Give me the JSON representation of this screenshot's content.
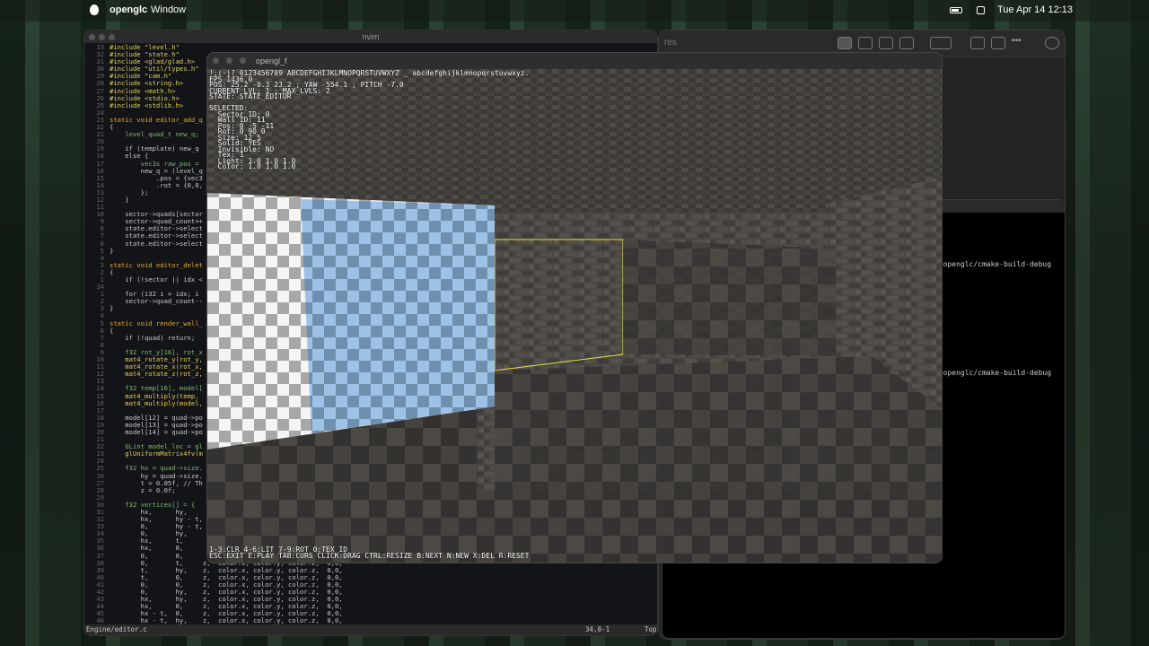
{
  "menubar": {
    "app_name": "openglc",
    "menu": [
      "Window"
    ],
    "clock": "Tue Apr 14  12:13"
  },
  "finder": {
    "title": "res"
  },
  "terminal": {
    "lines": [
      "s/openglc/cmake-build-debug",
      "s/openglc/cmake-build-debug"
    ]
  },
  "nvim": {
    "title": "nvim",
    "status_file": "Engine/editor.c",
    "status_pos": "34,0-1",
    "status_scroll": "Top",
    "lines": [
      {
        "n": "33",
        "t": "#include \"level.h\"",
        "c": "pp"
      },
      {
        "n": "32",
        "t": "#include \"state.h\"",
        "c": "pp"
      },
      {
        "n": "31",
        "t": "#include <glad/glad.h>",
        "c": "pp"
      },
      {
        "n": "30",
        "t": "#include \"util/types.h\"",
        "c": "pp"
      },
      {
        "n": "29",
        "t": "#include \"cam.h\"",
        "c": "pp"
      },
      {
        "n": "28",
        "t": "#include <string.h>",
        "c": "pp"
      },
      {
        "n": "27",
        "t": "#include <math.h>",
        "c": "pp"
      },
      {
        "n": "26",
        "t": "#include <stdio.h>",
        "c": "pp"
      },
      {
        "n": "25",
        "t": "#include <stdlib.h>",
        "c": "pp"
      },
      {
        "n": "24",
        "t": "",
        "c": ""
      },
      {
        "n": "23",
        "t": "static void editor_add_q",
        "c": "kw"
      },
      {
        "n": "22",
        "t": "{",
        "c": ""
      },
      {
        "n": "21",
        "t": "    level_quad_t new_q;",
        "c": "ty"
      },
      {
        "n": "20",
        "t": "",
        "c": ""
      },
      {
        "n": "19",
        "t": "    if (template) new_q",
        "c": ""
      },
      {
        "n": "18",
        "t": "    else {",
        "c": ""
      },
      {
        "n": "17",
        "t": "        vec3s raw_pos =",
        "c": "ty"
      },
      {
        "n": "16",
        "t": "        new_q = (level_q",
        "c": ""
      },
      {
        "n": "15",
        "t": "            .pos = {vec3",
        "c": ""
      },
      {
        "n": "14",
        "t": "            .rot = {0,0,",
        "c": ""
      },
      {
        "n": "13",
        "t": "        };",
        "c": ""
      },
      {
        "n": "12",
        "t": "    }",
        "c": ""
      },
      {
        "n": "11",
        "t": "",
        "c": ""
      },
      {
        "n": "10",
        "t": "    sector->quads[sector",
        "c": ""
      },
      {
        "n": "9",
        "t": "    sector->quad_count++",
        "c": ""
      },
      {
        "n": "8",
        "t": "    state.editor->select",
        "c": ""
      },
      {
        "n": "7",
        "t": "    state.editor->select",
        "c": ""
      },
      {
        "n": "6",
        "t": "    state.editor->select",
        "c": ""
      },
      {
        "n": "5",
        "t": "}",
        "c": ""
      },
      {
        "n": "4",
        "t": "",
        "c": ""
      },
      {
        "n": "3",
        "t": "static void editor_delet",
        "c": "kw"
      },
      {
        "n": "2",
        "t": "{",
        "c": ""
      },
      {
        "n": "1",
        "t": "    if (!sector || idx <",
        "c": ""
      },
      {
        "n": "34",
        "t": "",
        "c": ""
      },
      {
        "n": "1",
        "t": "    for (i32 i = idx; i",
        "c": ""
      },
      {
        "n": "2",
        "t": "    sector->quad_count--",
        "c": ""
      },
      {
        "n": "3",
        "t": "}",
        "c": ""
      },
      {
        "n": "4",
        "t": "",
        "c": ""
      },
      {
        "n": "5",
        "t": "static void render_wall_",
        "c": "kw"
      },
      {
        "n": "6",
        "t": "{",
        "c": ""
      },
      {
        "n": "7",
        "t": "    if (!quad) return;",
        "c": ""
      },
      {
        "n": "8",
        "t": "",
        "c": ""
      },
      {
        "n": "9",
        "t": "    f32 rot_y[16], rot_x",
        "c": "ty"
      },
      {
        "n": "10",
        "t": "    mat4_rotate_y(rot_y,",
        "c": "fn"
      },
      {
        "n": "11",
        "t": "    mat4_rotate_x(rot_x,",
        "c": "fn"
      },
      {
        "n": "12",
        "t": "    mat4_rotate_z(rot_z,",
        "c": "fn"
      },
      {
        "n": "13",
        "t": "",
        "c": ""
      },
      {
        "n": "14",
        "t": "    f32 temp[16], model[",
        "c": "ty"
      },
      {
        "n": "15",
        "t": "    mat4_multiply(temp,",
        "c": "fn"
      },
      {
        "n": "16",
        "t": "    mat4_multiply(model,",
        "c": "fn"
      },
      {
        "n": "17",
        "t": "",
        "c": ""
      },
      {
        "n": "18",
        "t": "    model[12] = quad->po",
        "c": ""
      },
      {
        "n": "19",
        "t": "    model[13] = quad->po",
        "c": ""
      },
      {
        "n": "20",
        "t": "    model[14] = quad->po",
        "c": ""
      },
      {
        "n": "21",
        "t": "",
        "c": ""
      },
      {
        "n": "22",
        "t": "    GLint model_loc = gl",
        "c": "ty"
      },
      {
        "n": "23",
        "t": "    glUniformMatrix4fv(m",
        "c": "fn"
      },
      {
        "n": "24",
        "t": "",
        "c": ""
      },
      {
        "n": "25",
        "t": "    f32 hx = quad->size.",
        "c": "ty"
      },
      {
        "n": "26",
        "t": "        hy = quad->size.",
        "c": ""
      },
      {
        "n": "27",
        "t": "        t = 0.05f, // Th",
        "c": ""
      },
      {
        "n": "28",
        "t": "        z = 0.0f;",
        "c": ""
      },
      {
        "n": "29",
        "t": "",
        "c": ""
      },
      {
        "n": "30",
        "t": "    f32 vertices[] = {",
        "c": "ty"
      },
      {
        "n": "31",
        "t": "        hx,      hy,",
        "c": ""
      },
      {
        "n": "32",
        "t": "        hx,      hy - t,",
        "c": ""
      },
      {
        "n": "33",
        "t": "        0,       hy - t,",
        "c": ""
      },
      {
        "n": "34",
        "t": "        0,       hy,",
        "c": ""
      },
      {
        "n": "35",
        "t": "        hx,      t,",
        "c": ""
      },
      {
        "n": "36",
        "t": "        hx,      0,",
        "c": ""
      },
      {
        "n": "37",
        "t": "        0,       0,",
        "c": ""
      },
      {
        "n": "38",
        "t": "        0,       t,     z,  color.x, color.y, color.z,  0,0,",
        "c": ""
      },
      {
        "n": "39",
        "t": "        t,       hy,    z,  color.x, color.y, color.z,  0,0,",
        "c": ""
      },
      {
        "n": "40",
        "t": "        t,       0,     z,  color.x, color.y, color.z,  0,0,",
        "c": ""
      },
      {
        "n": "41",
        "t": "        0,       0,     z,  color.x, color.y, color.z,  0,0,",
        "c": ""
      },
      {
        "n": "42",
        "t": "        0,       hy,    z,  color.x, color.y, color.z,  0,0,",
        "c": ""
      },
      {
        "n": "43",
        "t": "        hx,      hy,    z,  color.x, color.y, color.z,  0,0,",
        "c": ""
      },
      {
        "n": "44",
        "t": "        hx,      0,     z,  color.x, color.y, color.z,  0,0,",
        "c": ""
      },
      {
        "n": "45",
        "t": "        hx - t,  0,     z,  color.x, color.y, color.z,  0,0,",
        "c": ""
      },
      {
        "n": "46",
        "t": "        hx - t,  hy,    z,  color.x, color.y, color.z,  0,0,",
        "c": ""
      }
    ]
  },
  "gl": {
    "title": "opengl_f",
    "hud_top": "!;(-)? 0123456789 ABCDEFGHIJKLMNOPQRSTUVWXYZ _ abcdefghijklmnopqrstuvwxyz.\nFPS 1436.0\nPOS: 25.2 -0.3 23.2 ; YAW -554.1 ; PITCH -7.0\nCURRENT LVL: 1 ; MAX_LVLS: 2\nSTATE: STATE_EDITOR\n\nSELECTED:\n  Sector ID: 0\n  Wall ID: 11\n  Pos: 0 -5 -11\n  Rot: 0 90 0\n  Size: 12 5\n  Solid: YES\n  Invisible: NO\n  Tex: 1\n  Light: 1.0 1.0 1.0\n  Color: 1.0 1.0 1.0",
    "hud_bottom": "1-3:CLR 4-6:LIT 7-9:ROT 0:TEX_ID\nESC:EXIT E:PLAY TAB:CURS CLICK:DRAG CTRL:RESIZE B:NEXT N:NEW X:DEL R:RESET"
  },
  "colors": {
    "selection_outline": "#e8e040",
    "checker_blue": "#9ec2e6",
    "checker_gray": "#a7a7a7"
  }
}
